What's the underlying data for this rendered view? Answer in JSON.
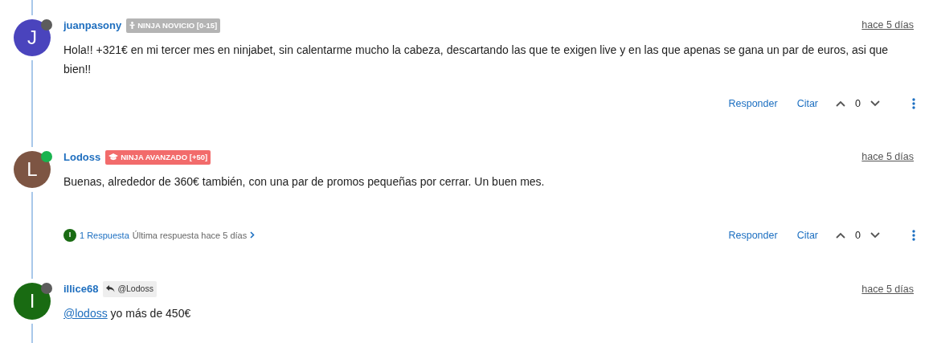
{
  "posts": [
    {
      "avatar": {
        "letter": "J",
        "color": "#4a44bd"
      },
      "online": false,
      "username": "juanpasony",
      "badge": {
        "kind": "rank",
        "text": "NINJA NOVICIO [0-15]",
        "color": "#b4b4b4"
      },
      "time": "hace 5 días",
      "body": "Hola!! +321€ en mi tercer mes en ninjabet, sin calentarme mucho la cabeza, descartando las que te exigen live y en las que apenas se gana un par de euros, asi que bien!!",
      "actions": {
        "reply": "Responder",
        "quote": "Citar",
        "votes": "0"
      }
    },
    {
      "avatar": {
        "letter": "L",
        "color": "#7d5543"
      },
      "online": true,
      "username": "Lodoss",
      "badge": {
        "kind": "graduate",
        "text": "NINJA AVANZADO [+50]",
        "color": "#f26b6b"
      },
      "time": "hace 5 días",
      "body": "Buenas, alrededor de 360€ también, con una par de promos pequeñas por cerrar. Un buen mes.",
      "replies": {
        "avatar": {
          "letter": "I",
          "color": "#196b12"
        },
        "count": "1 Respuesta",
        "last": "Última respuesta hace 5 días"
      },
      "actions": {
        "reply": "Responder",
        "quote": "Citar",
        "votes": "0"
      }
    },
    {
      "avatar": {
        "letter": "I",
        "color": "#196b12"
      },
      "online": false,
      "username": "illice68",
      "badge": {
        "kind": "reply-to",
        "text": "@Lodoss",
        "color": "#eeeeee"
      },
      "time": "hace 5 días",
      "mention": "@lodoss",
      "body": "yo más de 450€"
    }
  ]
}
